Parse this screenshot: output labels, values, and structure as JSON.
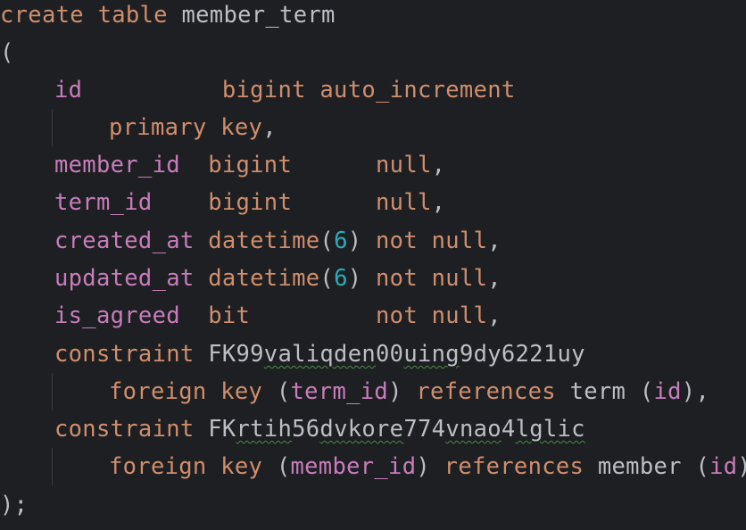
{
  "editor": {
    "lines": [
      [
        {
          "t": "create table ",
          "c": "kw"
        },
        {
          "t": "member_term",
          "c": "txt"
        }
      ],
      [
        {
          "t": "(",
          "c": "txt"
        }
      ],
      [
        {
          "t": "id",
          "c": "col"
        },
        {
          "t": "          ",
          "c": "txt"
        },
        {
          "t": "bigint auto_increment",
          "c": "kw"
        }
      ],
      [
        {
          "t": "primary key",
          "c": "kw"
        },
        {
          "t": ",",
          "c": "txt"
        }
      ],
      [
        {
          "t": "member_id",
          "c": "col"
        },
        {
          "t": "  ",
          "c": "txt"
        },
        {
          "t": "bigint",
          "c": "kw"
        },
        {
          "t": "      ",
          "c": "txt"
        },
        {
          "t": "null",
          "c": "kw"
        },
        {
          "t": ",",
          "c": "txt"
        }
      ],
      [
        {
          "t": "term_id",
          "c": "col"
        },
        {
          "t": "    ",
          "c": "txt"
        },
        {
          "t": "bigint",
          "c": "kw"
        },
        {
          "t": "      ",
          "c": "txt"
        },
        {
          "t": "null",
          "c": "kw"
        },
        {
          "t": ",",
          "c": "txt"
        }
      ],
      [
        {
          "t": "created_at",
          "c": "col"
        },
        {
          "t": " ",
          "c": "txt"
        },
        {
          "t": "datetime",
          "c": "kw"
        },
        {
          "t": "(",
          "c": "txt"
        },
        {
          "t": "6",
          "c": "num"
        },
        {
          "t": ") ",
          "c": "txt"
        },
        {
          "t": "not null",
          "c": "kw"
        },
        {
          "t": ",",
          "c": "txt"
        }
      ],
      [
        {
          "t": "updated_at",
          "c": "col"
        },
        {
          "t": " ",
          "c": "txt"
        },
        {
          "t": "datetime",
          "c": "kw"
        },
        {
          "t": "(",
          "c": "txt"
        },
        {
          "t": "6",
          "c": "num"
        },
        {
          "t": ") ",
          "c": "txt"
        },
        {
          "t": "not null",
          "c": "kw"
        },
        {
          "t": ",",
          "c": "txt"
        }
      ],
      [
        {
          "t": "is_agreed",
          "c": "col"
        },
        {
          "t": "  ",
          "c": "txt"
        },
        {
          "t": "bit",
          "c": "kw"
        },
        {
          "t": "         ",
          "c": "txt"
        },
        {
          "t": "not null",
          "c": "kw"
        },
        {
          "t": ",",
          "c": "txt"
        }
      ],
      [
        {
          "t": "constraint ",
          "c": "kw"
        },
        {
          "t": "FK99",
          "c": "txt"
        },
        {
          "t": "valiqden",
          "c": "txt typo"
        },
        {
          "t": "00",
          "c": "txt"
        },
        {
          "t": "uing",
          "c": "txt typo"
        },
        {
          "t": "9dy6221uy",
          "c": "txt"
        }
      ],
      [
        {
          "t": "foreign key ",
          "c": "kw"
        },
        {
          "t": "(",
          "c": "txt"
        },
        {
          "t": "term_id",
          "c": "col"
        },
        {
          "t": ") ",
          "c": "txt"
        },
        {
          "t": "references ",
          "c": "kw"
        },
        {
          "t": "term ",
          "c": "txt"
        },
        {
          "t": "(",
          "c": "txt"
        },
        {
          "t": "id",
          "c": "col"
        },
        {
          "t": "),",
          "c": "txt"
        }
      ],
      [
        {
          "t": "constraint ",
          "c": "kw"
        },
        {
          "t": "FK",
          "c": "txt"
        },
        {
          "t": "rtih",
          "c": "txt typo"
        },
        {
          "t": "56",
          "c": "txt"
        },
        {
          "t": "dvkore",
          "c": "txt typo"
        },
        {
          "t": "774",
          "c": "txt"
        },
        {
          "t": "vnao",
          "c": "txt typo"
        },
        {
          "t": "4",
          "c": "txt"
        },
        {
          "t": "lglic",
          "c": "txt typo"
        }
      ],
      [
        {
          "t": "foreign key ",
          "c": "kw"
        },
        {
          "t": "(",
          "c": "txt"
        },
        {
          "t": "member_id",
          "c": "col"
        },
        {
          "t": ") ",
          "c": "txt"
        },
        {
          "t": "references ",
          "c": "kw"
        },
        {
          "t": "member ",
          "c": "txt"
        },
        {
          "t": "(",
          "c": "txt"
        },
        {
          "t": "id",
          "c": "col"
        },
        {
          "t": ")",
          "c": "txt"
        }
      ],
      [
        {
          "t": ");",
          "c": "txt"
        }
      ]
    ]
  }
}
